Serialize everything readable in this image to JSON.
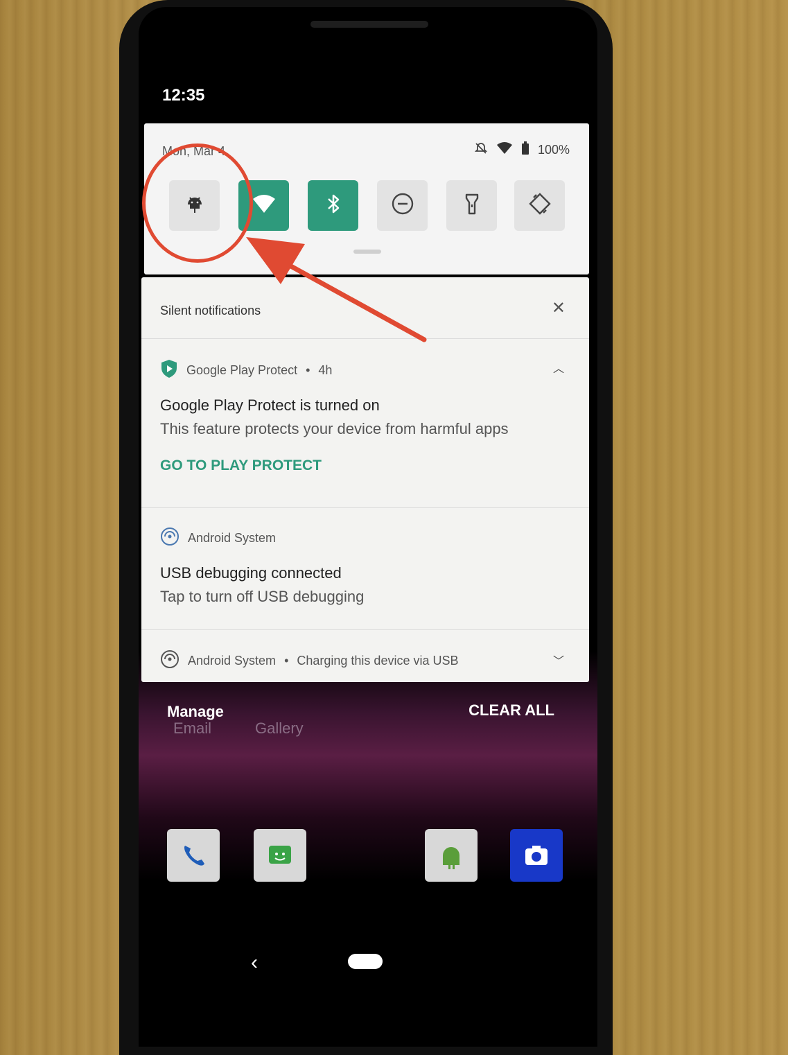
{
  "status_bar": {
    "time": "12:35",
    "battery": "100%"
  },
  "quick_settings": {
    "date": "Mon, Mar 4",
    "tiles": [
      {
        "name": "android-debug-tile",
        "icon": "android-icon",
        "on": false
      },
      {
        "name": "wifi-tile",
        "icon": "wifi-icon",
        "on": true
      },
      {
        "name": "bluetooth-tile",
        "icon": "bluetooth-icon",
        "on": true
      },
      {
        "name": "do-not-disturb-tile",
        "icon": "do-not-disturb-icon",
        "on": false
      },
      {
        "name": "flashlight-tile",
        "icon": "flashlight-icon",
        "on": false
      },
      {
        "name": "auto-rotate-tile",
        "icon": "auto-rotate-icon",
        "on": false
      }
    ]
  },
  "notifications": {
    "section_title": "Silent notifications",
    "play_protect": {
      "app": "Google Play Protect",
      "time": "4h",
      "title": "Google Play Protect is turned on",
      "text": "This feature protects your device from harmful apps",
      "action": "GO TO PLAY PROTECT"
    },
    "usb_debugging": {
      "app": "Android System",
      "title": "USB debugging connected",
      "text": "Tap to turn off USB debugging"
    },
    "charging": {
      "app": "Android System",
      "text": "Charging this device via USB"
    }
  },
  "shade_footer": {
    "manage": "Manage",
    "clear_all": "CLEAR ALL"
  },
  "home": {
    "app_labels": [
      "Email",
      "Gallery"
    ]
  },
  "colors": {
    "accent": "#2e9a7c",
    "annotation": "#e04a32"
  }
}
